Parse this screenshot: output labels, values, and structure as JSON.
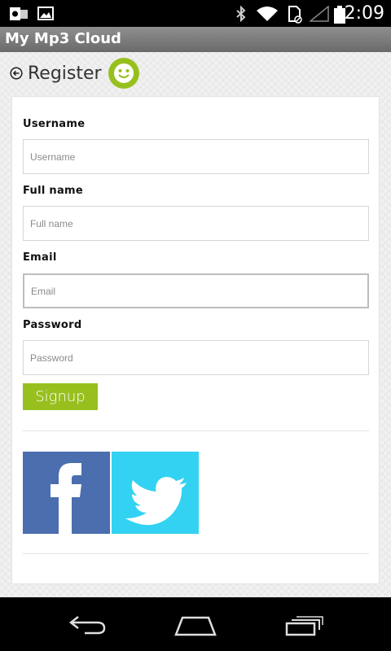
{
  "app": {
    "title": "My Mp3 Cloud"
  },
  "status": {
    "time": "2:09"
  },
  "header": {
    "title": "Register"
  },
  "form": {
    "username": {
      "label": "Username",
      "placeholder": "Username",
      "value": ""
    },
    "fullname": {
      "label": "Full name",
      "placeholder": "Full name",
      "value": ""
    },
    "email": {
      "label": "Email",
      "placeholder": "Email",
      "value": ""
    },
    "password": {
      "label": "Password",
      "placeholder": "Password",
      "value": ""
    },
    "signup_label": "Signup"
  },
  "colors": {
    "accent": "#97c01e",
    "facebook": "#4b6eae",
    "twitter": "#33d2f2"
  },
  "icons": [
    "outlook-icon",
    "image-icon",
    "bluetooth-icon",
    "wifi-icon",
    "sim-icon",
    "signal-icon",
    "battery-icon",
    "back-icon",
    "smiley-icon",
    "facebook-icon",
    "twitter-icon",
    "nav-back-icon",
    "nav-home-icon",
    "nav-recents-icon"
  ]
}
